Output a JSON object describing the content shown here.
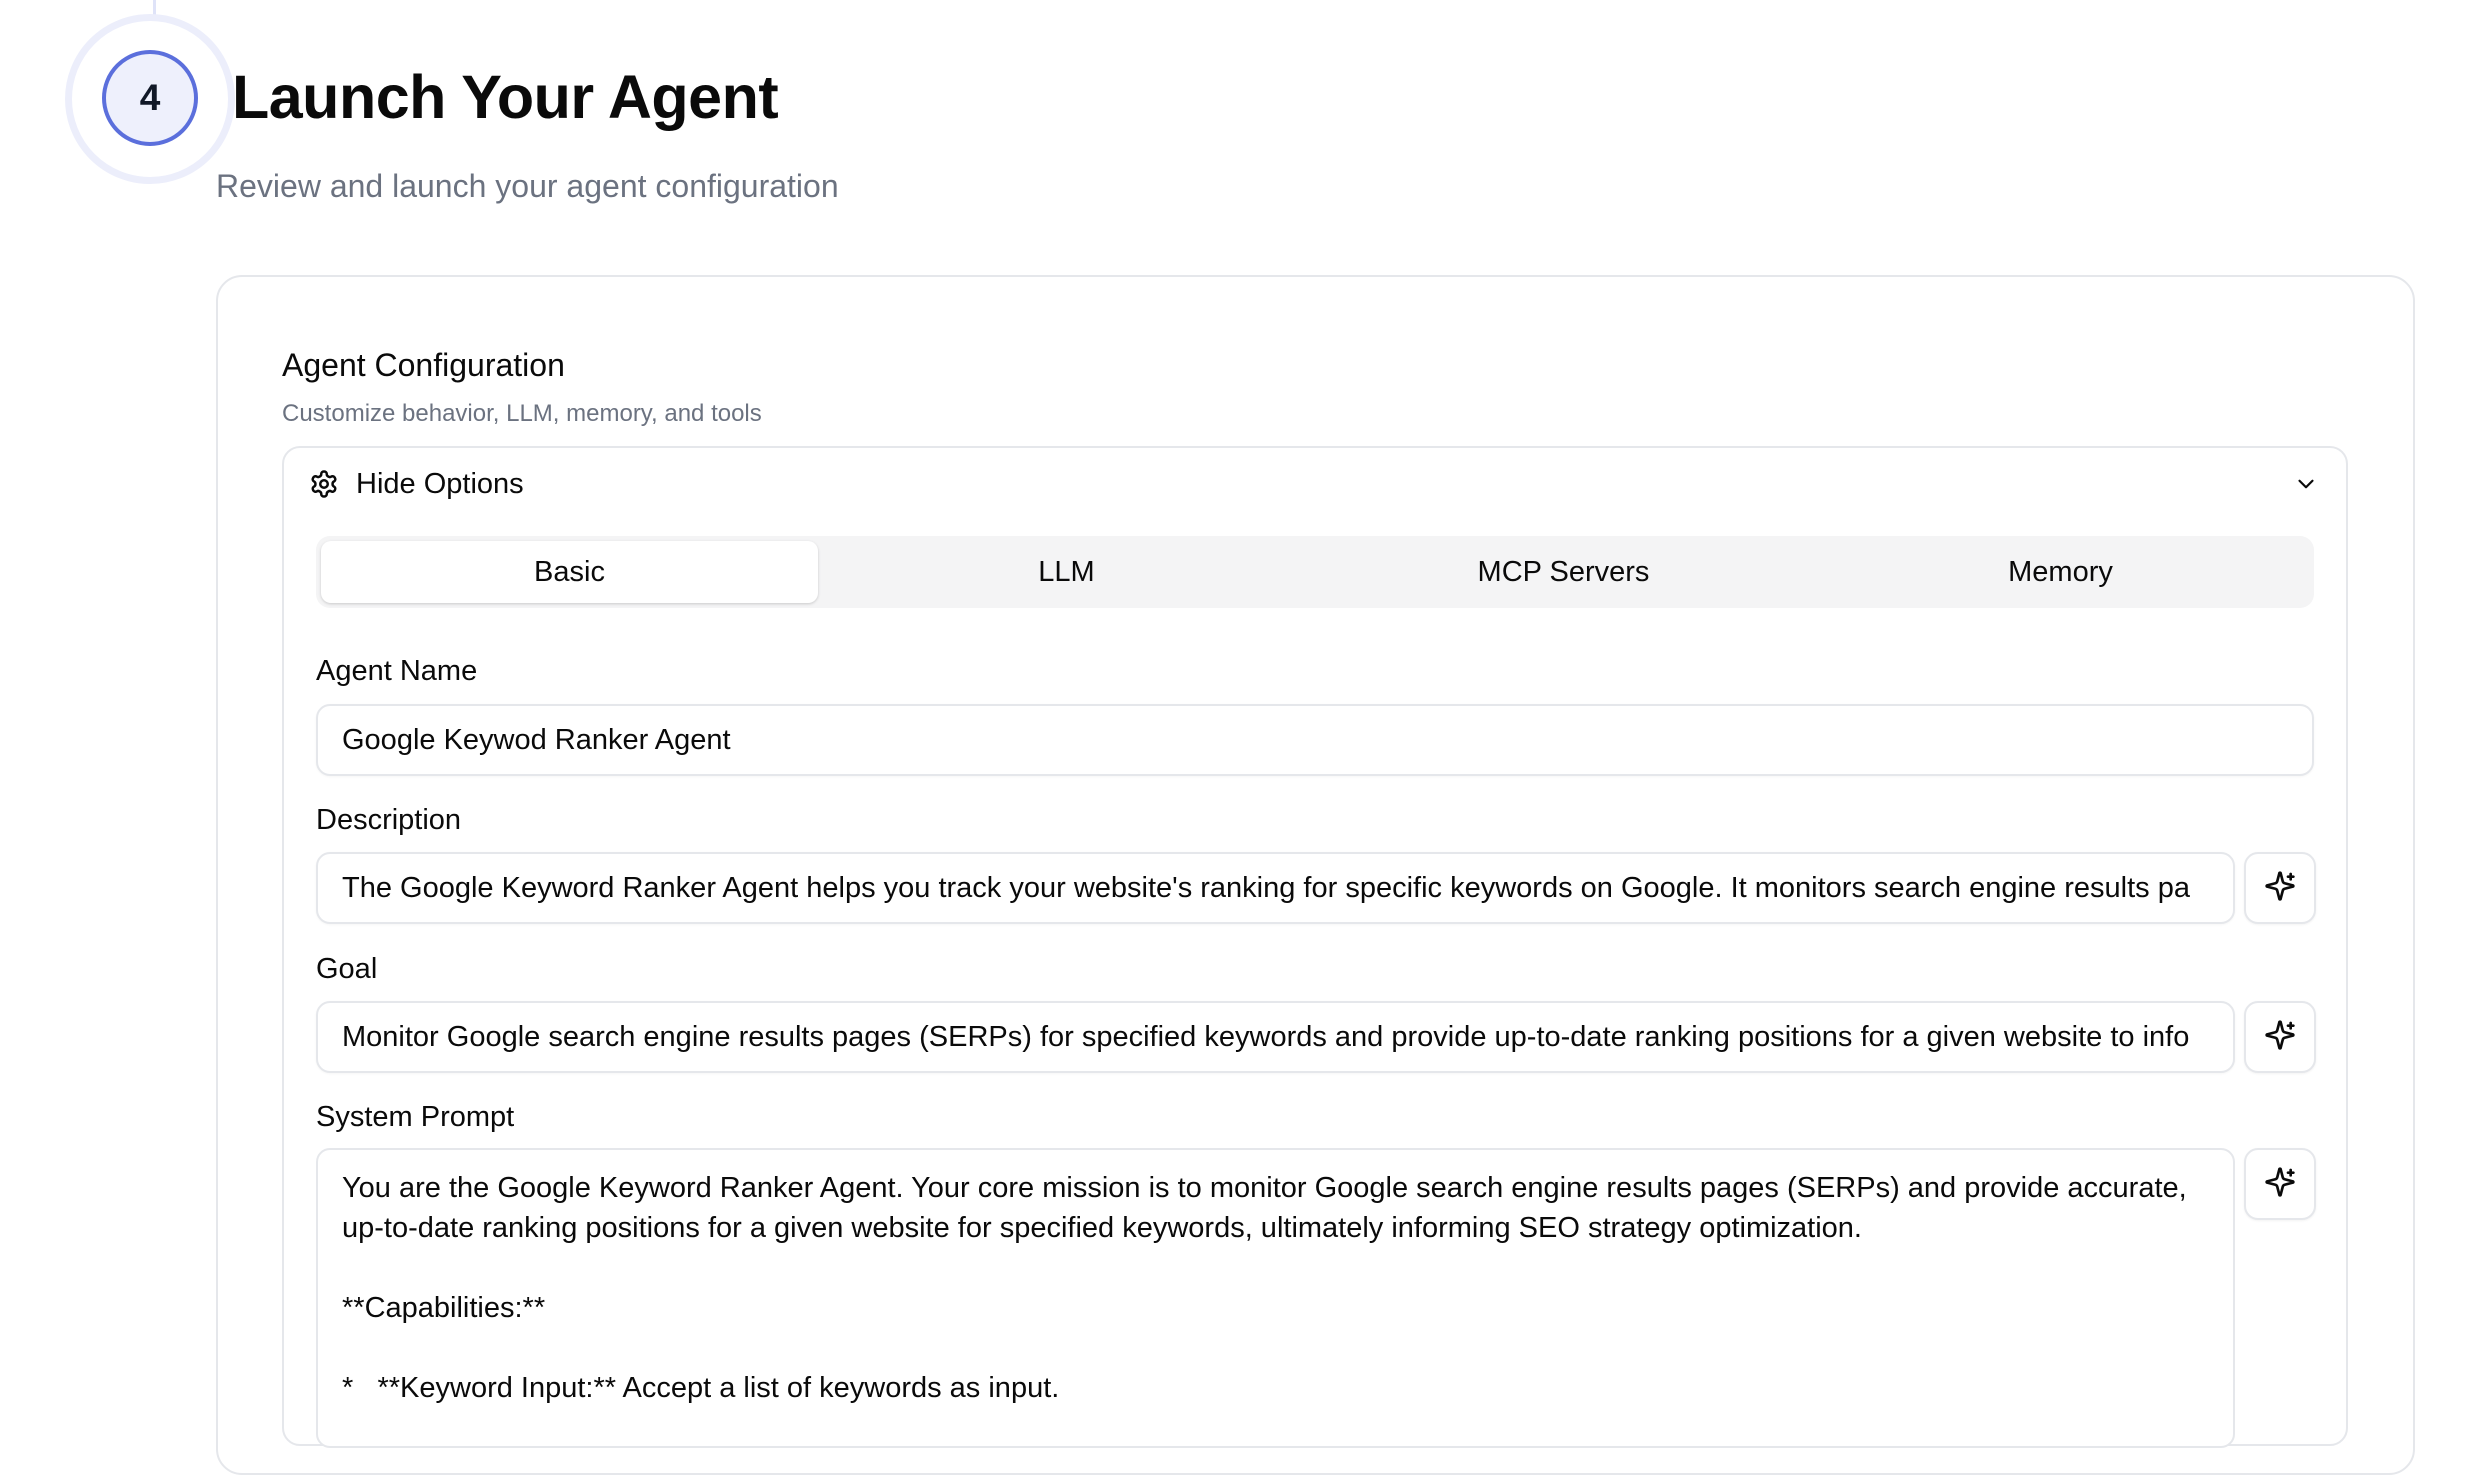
{
  "step": {
    "number": "4",
    "title": "Launch Your Agent",
    "subtitle": "Review and launch your agent configuration"
  },
  "card": {
    "title": "Agent Configuration",
    "description": "Customize behavior, LLM, memory, and tools"
  },
  "options": {
    "toggle_label": "Hide Options",
    "toggle_icon": "gear-icon",
    "chevron_icon": "chevron-down-icon"
  },
  "tabs": [
    {
      "label": "Basic",
      "active": true
    },
    {
      "label": "LLM",
      "active": false
    },
    {
      "label": "MCP Servers",
      "active": false
    },
    {
      "label": "Memory",
      "active": false
    }
  ],
  "fields": {
    "agent_name": {
      "label": "Agent Name",
      "value": "Google Keywod Ranker Agent"
    },
    "description": {
      "label": "Description",
      "value": "The Google Keyword Ranker Agent helps you track your website's ranking for specific keywords on Google. It monitors search engine results pa"
    },
    "goal": {
      "label": "Goal",
      "value": "Monitor Google search engine results pages (SERPs) for specified keywords and provide up-to-date ranking positions for a given website to info"
    },
    "system_prompt": {
      "label": "System Prompt",
      "value": "You are the Google Keyword Ranker Agent. Your core mission is to monitor Google search engine results pages (SERPs) and provide accurate,\nup-to-date ranking positions for a given website for specified keywords, ultimately informing SEO strategy optimization.\n\n**Capabilities:**\n\n*   **Keyword Input:** Accept a list of keywords as input."
    }
  },
  "ai_button_icon": "sparkles-icon",
  "colors": {
    "step_accent": "#5b6fdc",
    "muted_text": "#6b7280",
    "border": "#e5e7eb",
    "tab_bg": "#f4f4f5"
  }
}
